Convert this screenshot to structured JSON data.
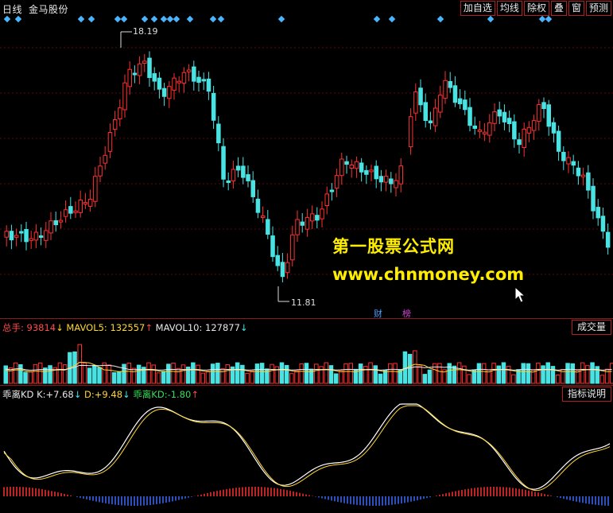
{
  "header": {
    "period": "日线",
    "stock_name": "金马股份",
    "toolbar": [
      "加自选",
      "均线",
      "除权",
      "叠",
      "窗",
      "预测"
    ]
  },
  "price_chart": {
    "high_label": "18.19",
    "low_label": "11.81",
    "tags": [
      "财",
      "榜"
    ],
    "up_color": "#ff3030",
    "down_color": "#4ae3e3"
  },
  "volume_panel": {
    "name": "总手:",
    "value": "93814",
    "value_arrow": "↓",
    "mavol5_label": "MAVOL5:",
    "mavol5_value": "132557",
    "mavol5_arrow": "↑",
    "mavol10_label": "MAVOL10:",
    "mavol10_value": "127877",
    "mavol10_arrow": "↓",
    "button": "成交量"
  },
  "kd_panel": {
    "name": "乖离KD",
    "k_label": "K:",
    "k_value": "+7.68",
    "k_arrow": "↓",
    "d_label": "D:",
    "d_value": "+9.48",
    "d_arrow": "↓",
    "diff_label": "乖离KD:",
    "diff_value": "-1.80",
    "diff_arrow": "↑",
    "button": "指标说明"
  },
  "watermark": {
    "line1": "第一股票公式网",
    "line2": "www.chnmoney.com"
  }
}
